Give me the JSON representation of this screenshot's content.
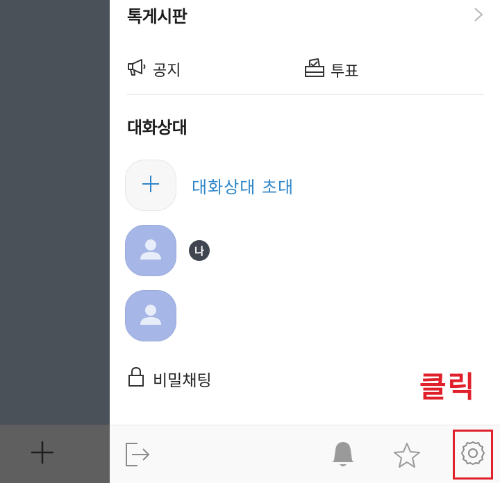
{
  "board": {
    "title": "톡게시판",
    "items": [
      {
        "label": "공지",
        "icon": "megaphone-icon"
      },
      {
        "label": "투표",
        "icon": "ballot-box-icon"
      }
    ]
  },
  "partners": {
    "title": "대화상대",
    "invite_label": "대화상대 초대",
    "me_badge": "나"
  },
  "secret_chat": {
    "label": "비밀채팅"
  },
  "annotation": {
    "click_label": "클릭",
    "color": "#e0202a"
  },
  "colors": {
    "accent_blue": "#2e86c9",
    "avatar": "#a6b6e6",
    "sidebar": "#4a5159"
  }
}
